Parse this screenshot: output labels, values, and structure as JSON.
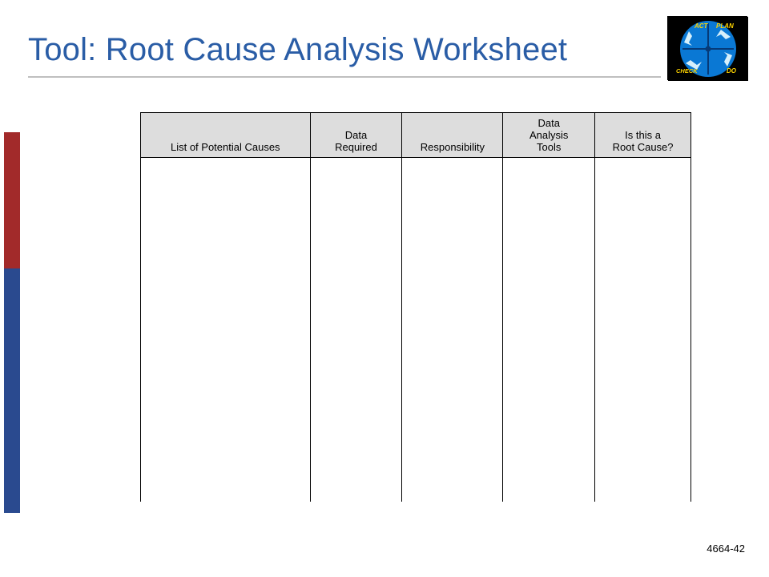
{
  "title": "Tool: Root Cause Analysis Worksheet",
  "pdca": {
    "act": "ACT",
    "plan": "PLAN",
    "do": "DO",
    "check": "CHECK"
  },
  "table": {
    "headers": {
      "causes": "List of Potential Causes",
      "data_required": "Data Required",
      "responsibility": "Responsibility",
      "analysis_tools": "Data Analysis Tools",
      "root_cause": "Is this a Root Cause?"
    }
  },
  "page_number": "4664-42"
}
